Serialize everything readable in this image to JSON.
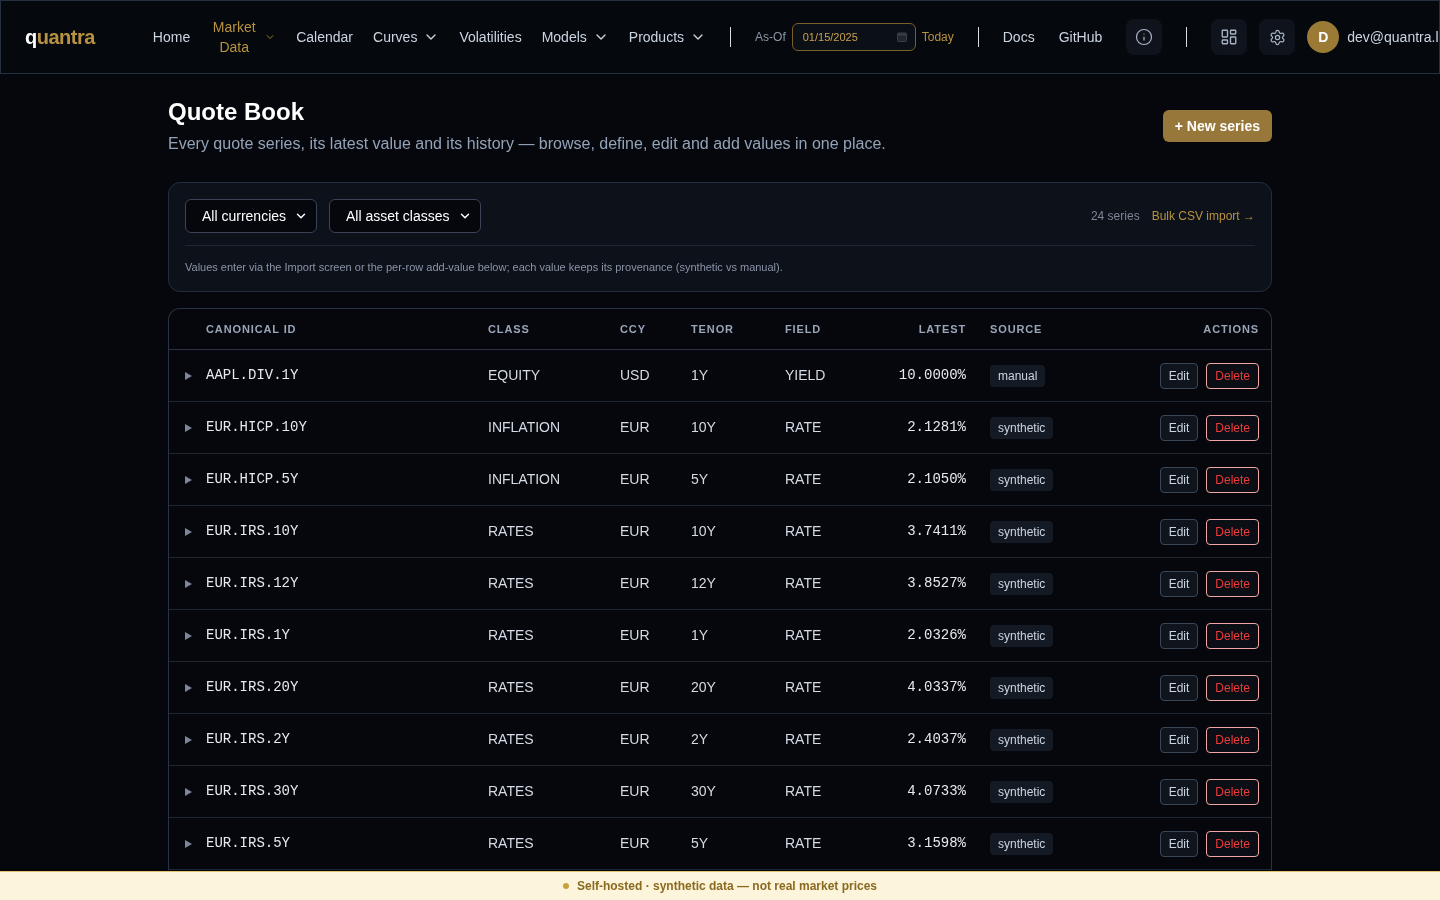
{
  "header": {
    "logo": "quantra",
    "nav": [
      {
        "label": "Home",
        "selected": false,
        "has_menu": false
      },
      {
        "label": "Market Data",
        "selected": true,
        "has_menu": true
      },
      {
        "label": "Calendar",
        "selected": false,
        "has_menu": false
      },
      {
        "label": "Curves",
        "selected": false,
        "has_menu": true
      },
      {
        "label": "Volatilities",
        "selected": false,
        "has_menu": false
      },
      {
        "label": "Models",
        "selected": false,
        "has_menu": true
      },
      {
        "label": "Products",
        "selected": false,
        "has_menu": true
      }
    ],
    "as_of": {
      "label": "As-Of",
      "value": "01/15/2025",
      "today": "Today"
    },
    "links": [
      "Docs",
      "GitHub"
    ],
    "user": {
      "initial": "D",
      "email": "dev@quantra.l"
    }
  },
  "page": {
    "title": "Quote Book",
    "subtitle": "Every quote series, its latest value and its history — browse, define, edit and add values in one place.",
    "new_button": "+ New series"
  },
  "filters": {
    "selects": [
      "All currencies",
      "All asset classes"
    ],
    "count": "24 series",
    "import_link": "Bulk CSV import →",
    "note": "Values enter via the Import screen or the per-row add-value below; each value keeps its provenance (synthetic vs manual)."
  },
  "table": {
    "columns": [
      "CANONICAL ID",
      "CLASS",
      "CCY",
      "TENOR",
      "FIELD",
      "LATEST",
      "SOURCE",
      "ACTIONS"
    ],
    "rows": [
      {
        "expanded": false,
        "id": "AAPL.DIV.1Y",
        "class": "EQUITY",
        "ccy": "USD",
        "tenor": "1Y",
        "field": "YIELD",
        "latest": "10.0000%",
        "source": "manual",
        "actions": [
          {
            "label": "Edit",
            "kind": "neutral"
          },
          {
            "label": "Delete",
            "kind": "danger"
          }
        ]
      },
      {
        "expanded": false,
        "id": "EUR.HICP.10Y",
        "class": "INFLATION",
        "ccy": "EUR",
        "tenor": "10Y",
        "field": "RATE",
        "latest": "2.1281%",
        "source": "synthetic",
        "actions": [
          {
            "label": "Edit",
            "kind": "neutral"
          },
          {
            "label": "Delete",
            "kind": "danger"
          }
        ]
      },
      {
        "expanded": false,
        "id": "EUR.HICP.5Y",
        "class": "INFLATION",
        "ccy": "EUR",
        "tenor": "5Y",
        "field": "RATE",
        "latest": "2.1050%",
        "source": "synthetic",
        "actions": [
          {
            "label": "Edit",
            "kind": "neutral"
          },
          {
            "label": "Delete",
            "kind": "danger"
          }
        ]
      },
      {
        "expanded": false,
        "id": "EUR.IRS.10Y",
        "class": "RATES",
        "ccy": "EUR",
        "tenor": "10Y",
        "field": "RATE",
        "latest": "3.7411%",
        "source": "synthetic",
        "actions": [
          {
            "label": "Edit",
            "kind": "neutral"
          },
          {
            "label": "Delete",
            "kind": "danger"
          }
        ]
      },
      {
        "expanded": false,
        "id": "EUR.IRS.12Y",
        "class": "RATES",
        "ccy": "EUR",
        "tenor": "12Y",
        "field": "RATE",
        "latest": "3.8527%",
        "source": "synthetic",
        "actions": [
          {
            "label": "Edit",
            "kind": "neutral"
          },
          {
            "label": "Delete",
            "kind": "danger"
          }
        ]
      },
      {
        "expanded": false,
        "id": "EUR.IRS.1Y",
        "class": "RATES",
        "ccy": "EUR",
        "tenor": "1Y",
        "field": "RATE",
        "latest": "2.0326%",
        "source": "synthetic",
        "actions": [
          {
            "label": "Edit",
            "kind": "neutral"
          },
          {
            "label": "Delete",
            "kind": "danger"
          }
        ]
      },
      {
        "expanded": false,
        "id": "EUR.IRS.20Y",
        "class": "RATES",
        "ccy": "EUR",
        "tenor": "20Y",
        "field": "RATE",
        "latest": "4.0337%",
        "source": "synthetic",
        "actions": [
          {
            "label": "Edit",
            "kind": "neutral"
          },
          {
            "label": "Delete",
            "kind": "danger"
          }
        ]
      },
      {
        "expanded": false,
        "id": "EUR.IRS.2Y",
        "class": "RATES",
        "ccy": "EUR",
        "tenor": "2Y",
        "field": "RATE",
        "latest": "2.4037%",
        "source": "synthetic",
        "actions": [
          {
            "label": "Edit",
            "kind": "neutral"
          },
          {
            "label": "Delete",
            "kind": "danger"
          }
        ]
      },
      {
        "expanded": false,
        "id": "EUR.IRS.30Y",
        "class": "RATES",
        "ccy": "EUR",
        "tenor": "30Y",
        "field": "RATE",
        "latest": "4.0733%",
        "source": "synthetic",
        "actions": [
          {
            "label": "Edit",
            "kind": "neutral"
          },
          {
            "label": "Delete",
            "kind": "danger"
          }
        ]
      },
      {
        "expanded": false,
        "id": "EUR.IRS.5Y",
        "class": "RATES",
        "ccy": "EUR",
        "tenor": "5Y",
        "field": "RATE",
        "latest": "3.1598%",
        "source": "synthetic",
        "actions": [
          {
            "label": "Edit",
            "kind": "neutral"
          },
          {
            "label": "Delete",
            "kind": "danger"
          }
        ]
      }
    ]
  },
  "banner": "Self-hosted · synthetic data — not real market prices"
}
